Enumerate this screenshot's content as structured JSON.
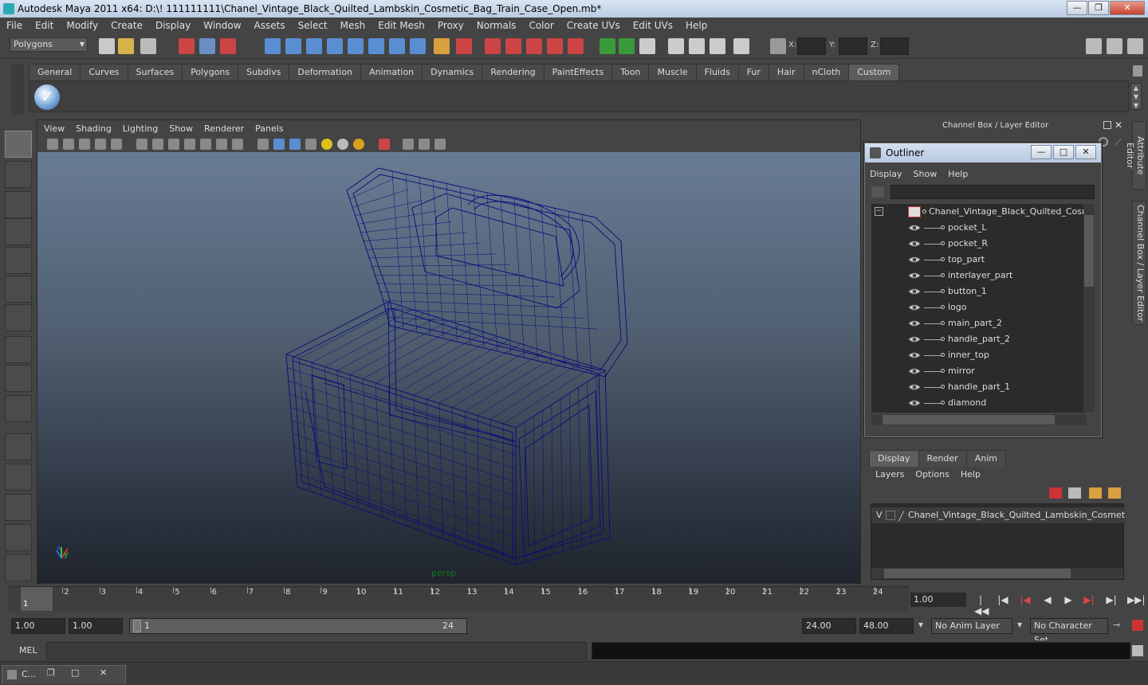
{
  "window": {
    "title": "Autodesk Maya 2011 x64: D:\\! 111111111\\Chanel_Vintage_Black_Quilted_Lambskin_Cosmetic_Bag_Train_Case_Open.mb*",
    "minimize": "—",
    "restore": "❐",
    "close": "✕"
  },
  "menubar": [
    "File",
    "Edit",
    "Modify",
    "Create",
    "Display",
    "Window",
    "Assets",
    "Select",
    "Mesh",
    "Edit Mesh",
    "Proxy",
    "Normals",
    "Color",
    "Create UVs",
    "Edit UVs",
    "Help"
  ],
  "statusline": {
    "mode": "Polygons",
    "x_label": "X:",
    "y_label": "Y:",
    "z_label": "Z:"
  },
  "shelf": {
    "tabs": [
      "General",
      "Curves",
      "Surfaces",
      "Polygons",
      "Subdivs",
      "Deformation",
      "Animation",
      "Dynamics",
      "Rendering",
      "PaintEffects",
      "Toon",
      "Muscle",
      "Fluids",
      "Fur",
      "Hair",
      "nCloth",
      "Custom"
    ],
    "active_tab": "Custom"
  },
  "viewport": {
    "menu": [
      "View",
      "Shading",
      "Lighting",
      "Show",
      "Renderer",
      "Panels"
    ],
    "camera_label": "persp",
    "wire_color": "#0a0a7a"
  },
  "channel_box": {
    "title": "Channel Box / Layer Editor"
  },
  "side_tabs": [
    "Attribute Editor",
    "Channel Box / Layer Editor"
  ],
  "outliner": {
    "title": "Outliner",
    "menu": [
      "Display",
      "Show",
      "Help"
    ],
    "root": "Chanel_Vintage_Black_Quilted_Cosmetic",
    "items": [
      "pocket_L",
      "pocket_R",
      "top_part",
      "interlayer_part",
      "button_1",
      "logo",
      "main_part_2",
      "handle_part_2",
      "inner_top",
      "mirror",
      "handle_part_1",
      "diamond"
    ]
  },
  "layer_editor": {
    "tabs": [
      "Display",
      "Render",
      "Anim"
    ],
    "active_tab": "Display",
    "menu": [
      "Layers",
      "Options",
      "Help"
    ],
    "layer_visible": "V",
    "layer_name": "Chanel_Vintage_Black_Quilted_Lambskin_Cosmetic_Bag_"
  },
  "timeline": {
    "ticks": [
      "1",
      "2",
      "3",
      "4",
      "5",
      "6",
      "7",
      "8",
      "9",
      "10",
      "11",
      "12",
      "13",
      "14",
      "15",
      "16",
      "17",
      "18",
      "19",
      "20",
      "21",
      "22",
      "23",
      "24"
    ],
    "current_frame_marker": "1",
    "current_frame": "1.00"
  },
  "range": {
    "start": "1.00",
    "playback_start": "1.00",
    "slider_start": "1",
    "slider_end": "24",
    "playback_end": "24.00",
    "end": "48.00",
    "anim_layer": "No Anim Layer",
    "character_set": "No Character Set"
  },
  "cmdline": {
    "label": "MEL"
  },
  "taskbar": {
    "window_label": "C..."
  }
}
